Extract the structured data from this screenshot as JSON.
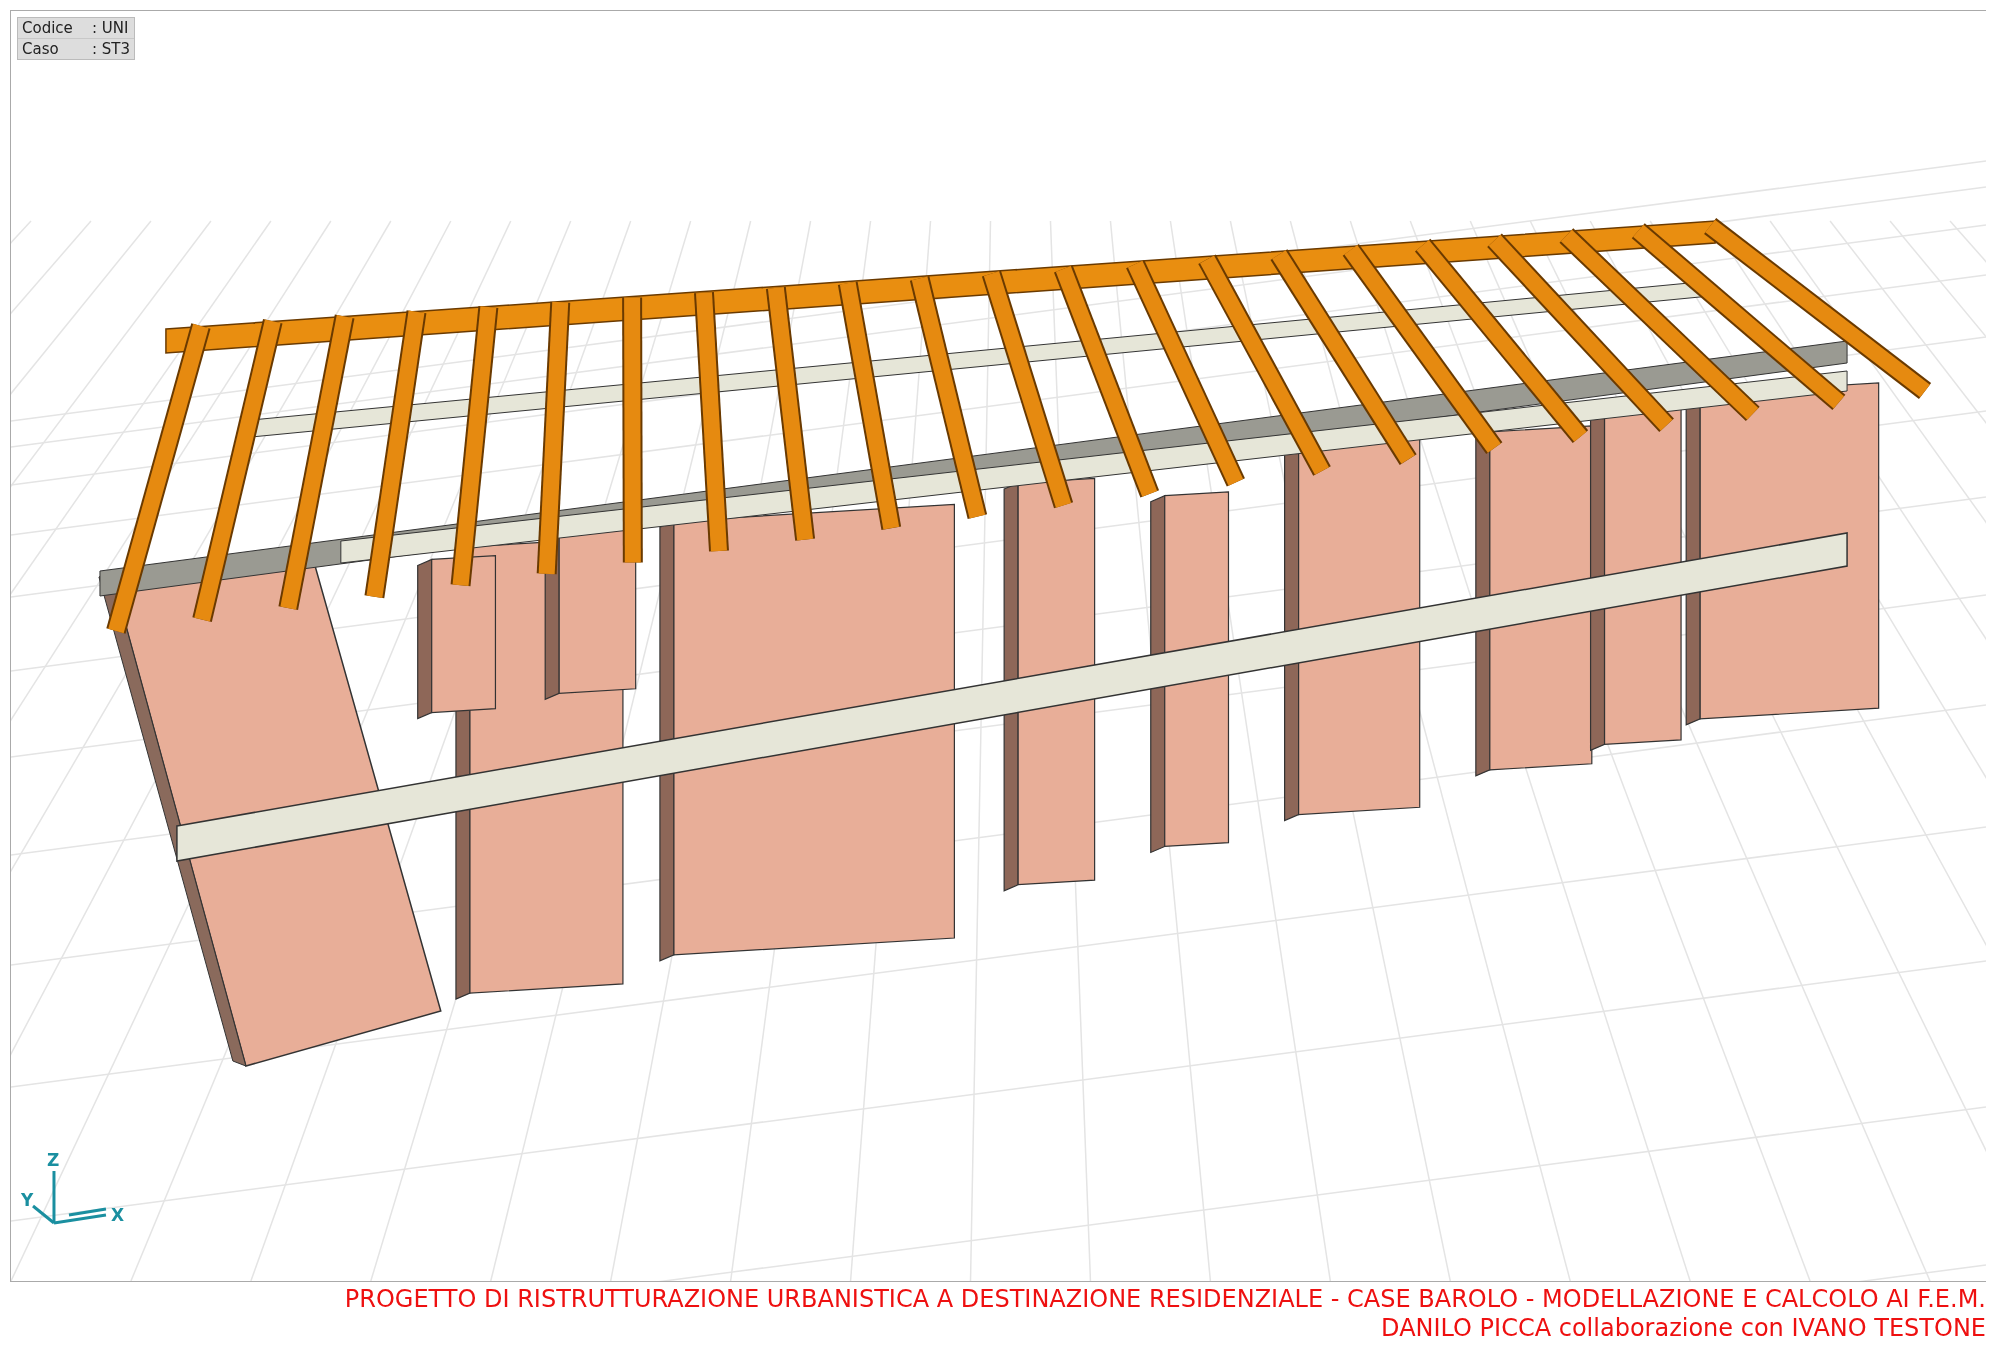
{
  "info_box": {
    "rows": [
      {
        "label": "Codice",
        "value": ": UNI"
      },
      {
        "label": "Caso",
        "value": ": ST3"
      }
    ]
  },
  "axes": {
    "z": "Z",
    "y": "Y",
    "x": "X"
  },
  "footer": {
    "lines": [
      "PROGETTO DI RISTRUTTURAZIONE URBANISTICA A DESTINAZIONE RESIDENZIALE - CASE BAROLO - MODELLAZIONE E CALCOLO AI F.E.M.",
      "DANILO PICCA collaborazione con IVANO TESTONE"
    ]
  }
}
